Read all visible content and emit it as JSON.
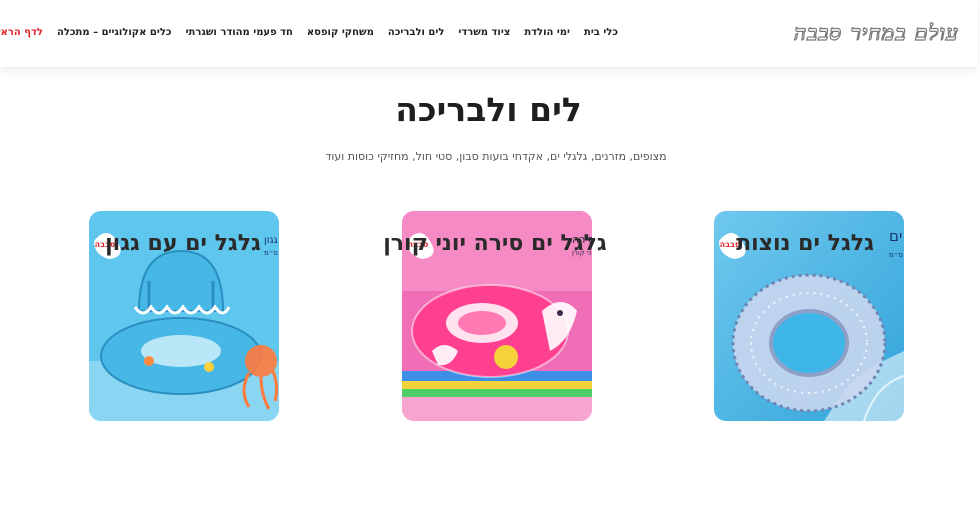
{
  "header": {
    "logo_text": "עולם במחיר סבבה",
    "nav": [
      {
        "label": "כלי בית"
      },
      {
        "label": "ימי הולדת"
      },
      {
        "label": "ציוד משרדי"
      },
      {
        "label": "לים ולבריכה"
      },
      {
        "label": "משחקי קופסא"
      },
      {
        "label": "חד פעמי מהודר ושגרתי"
      },
      {
        "label": "כלים אקולוגיים – מתכלה"
      },
      {
        "label": "לדף הראשי",
        "color": "#e0242a"
      }
    ]
  },
  "hero": {
    "title": "לים ולבריכה",
    "subtitle": "מצופים, מזרנים, גלגלי ים, אקדחי בועות סבון, סטי חול, מחזיקי כוסות ועוד"
  },
  "products": [
    {
      "title": "גלגל ים נוצות",
      "package_brand": "סבבה",
      "package_title": "גלגל ים",
      "package_sub": "90 ס״מ",
      "image_icon": "transparent-feather-swim-ring",
      "colors": {
        "bg": "#3fb6e8",
        "ring": "#c9d6ee"
      }
    },
    {
      "title": "גלגל ים סירה יוני קורן",
      "package_brand": "סבבה",
      "package_title": "גלגל ים סירה",
      "package_sub": "יוני קורן",
      "image_icon": "pink-unicorn-boat-float",
      "colors": {
        "bg": "#f06eb6",
        "ring": "#ff3f8f"
      }
    },
    {
      "title": "גלגל ים עם גגון",
      "package_brand": "סבבה",
      "package_title": "גלגל ים עם גגון",
      "package_sub": "70 ס״מ",
      "image_icon": "blue-baby-float-with-canopy",
      "colors": {
        "bg": "#5fc6ee",
        "ring": "#47b8e6"
      }
    }
  ]
}
